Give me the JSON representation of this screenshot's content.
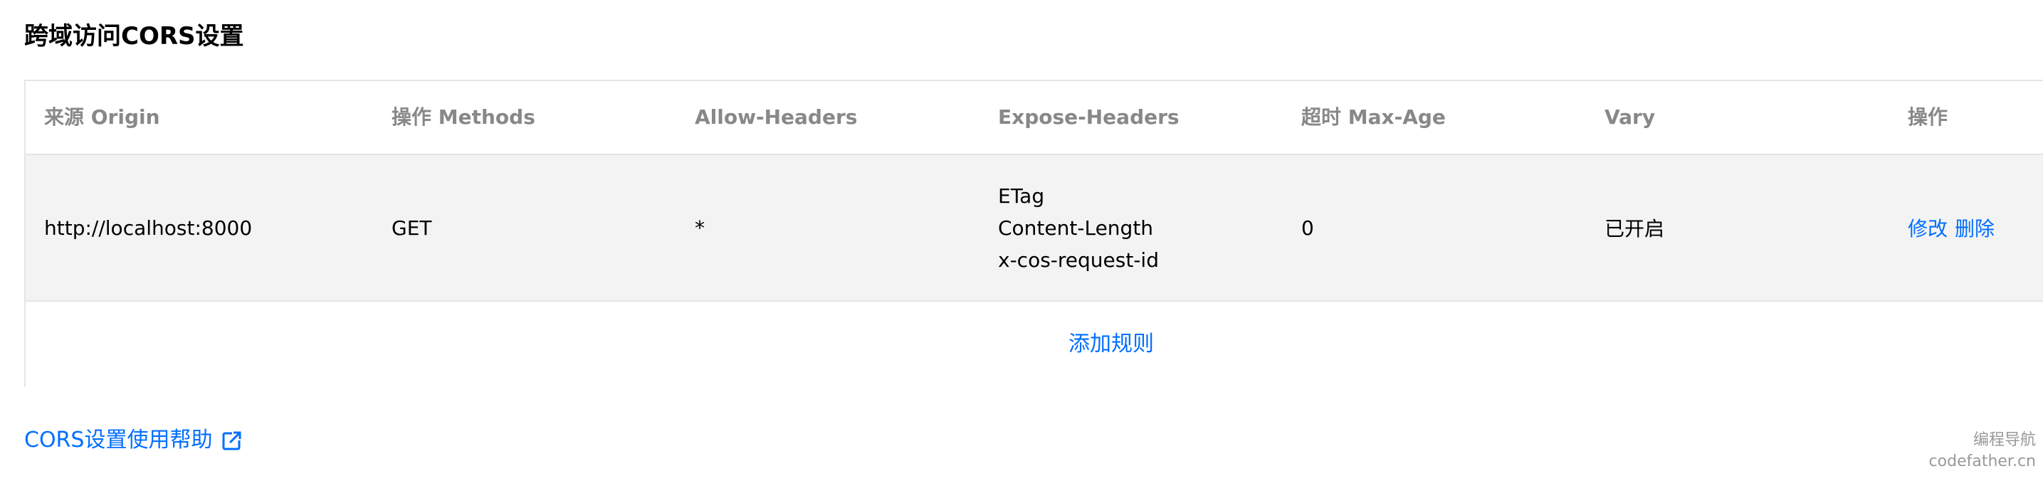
{
  "page": {
    "title": "跨域访问CORS设置",
    "help_link": "CORS设置使用帮助",
    "help_icon": "external-link-icon"
  },
  "table": {
    "headers": {
      "origin": "来源 Origin",
      "methods": "操作 Methods",
      "allow_headers": "Allow-Headers",
      "expose_headers": "Expose-Headers",
      "max_age": "超时 Max-Age",
      "vary": "Vary",
      "actions": "操作"
    },
    "rows": [
      {
        "origin": "http://localhost:8000",
        "methods": "GET",
        "allow_headers": "*",
        "expose_headers": [
          "ETag",
          "Content-Length",
          "x-cos-request-id"
        ],
        "max_age": "0",
        "vary": "已开启",
        "edit_label": "修改",
        "delete_label": "删除"
      }
    ],
    "add_rule_label": "添加规则"
  },
  "watermark": {
    "line1": "编程导航",
    "line2": "codefather.cn"
  },
  "colors": {
    "link": "#006eff",
    "header_text": "#888888",
    "row_bg": "#f3f3f3",
    "border": "#e5e5e5"
  }
}
